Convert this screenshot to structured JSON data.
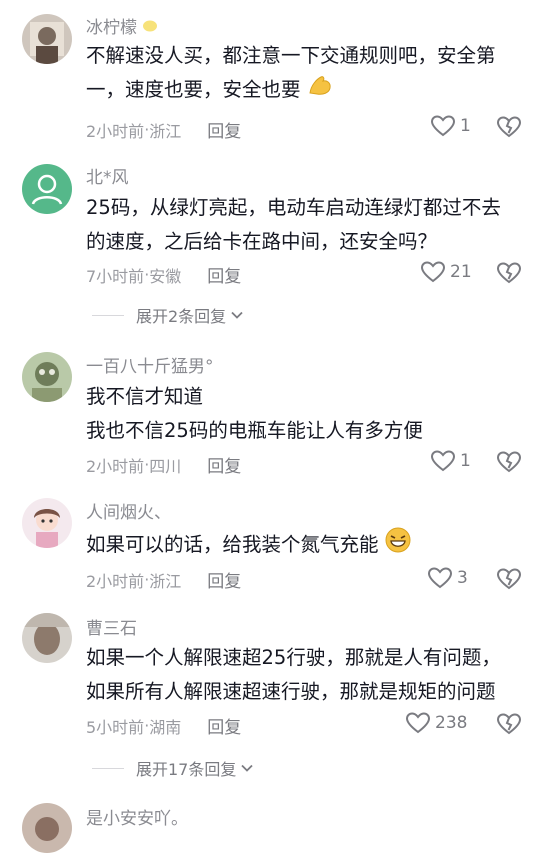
{
  "comments": [
    {
      "username": "冰柠檬",
      "lines": [
        "不解速没人买，都注意一下交通规则吧，安全第",
        "一，速度也要，安全也要"
      ],
      "time": "2小时前",
      "location": "浙江",
      "reply_label": "回复",
      "likes": "1",
      "username_icon": "lemon-emoji-icon",
      "trailing_emoji": "flexed-biceps-emoji-icon"
    },
    {
      "username": "北*风",
      "lines": [
        "25码，从绿灯亮起，电动车启动连绿灯都过不去",
        "的速度，之后给卡在路中间，还安全吗？"
      ],
      "time": "7小时前",
      "location": "安徽",
      "reply_label": "回复",
      "likes": "21",
      "expand_label": "展开2条回复"
    },
    {
      "username": "一百八十斤猛男°",
      "lines": [
        "我不信才知道",
        "我也不信25码的电瓶车能让人有多方便"
      ],
      "time": "2小时前",
      "location": "四川",
      "reply_label": "回复",
      "likes": "1"
    },
    {
      "username": "人间烟火、",
      "lines": [
        "如果可以的话，给我装个氮气充能"
      ],
      "time": "2小时前",
      "location": "浙江",
      "reply_label": "回复",
      "likes": "3",
      "trailing_emoji": "grinning-face-emoji-icon"
    },
    {
      "username": "曹三石",
      "lines": [
        "如果一个人解限速超25行驶，那就是人有问题，",
        "如果所有人解限速超速行驶，那就是规矩的问题"
      ],
      "time": "5小时前",
      "location": "湖南",
      "reply_label": "回复",
      "likes": "238",
      "expand_label": "展开17条回复"
    },
    {
      "username": "是小安安吖。"
    }
  ],
  "meta_separator": " · ",
  "colors": {
    "text": "#161823",
    "secondary": "#8a8b91",
    "emoji_yellow": "#f5c242"
  }
}
